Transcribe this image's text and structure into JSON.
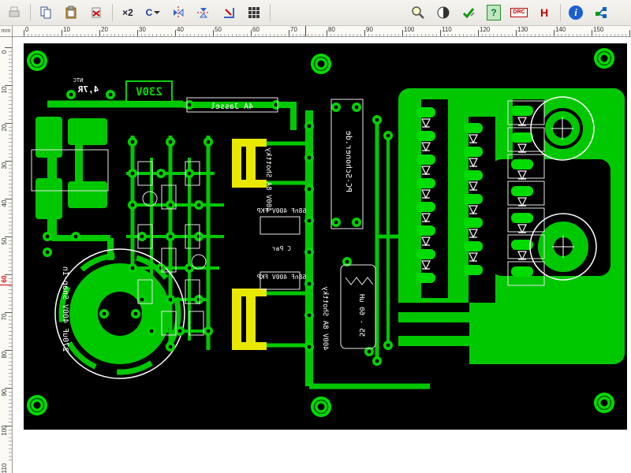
{
  "toolbar": {
    "icons": [
      "print",
      "copy",
      "paste",
      "delete",
      "scale-x2",
      "rotate",
      "mirror-horizontal",
      "mirror-vertical",
      "flip",
      "array",
      "zoom",
      "contrast",
      "check",
      "help",
      "drc",
      "highlight-h",
      "info",
      "footprint"
    ],
    "labels": {
      "scale_x2": "×2",
      "rotate": "C",
      "drc": "DRC",
      "h": "H",
      "help": "?",
      "info": "i"
    }
  },
  "rulers": {
    "unit": "mm",
    "h_ticks": [
      "0",
      "10",
      "20",
      "30",
      "40",
      "50",
      "60",
      "70",
      "80",
      "90",
      "100",
      "110",
      "120",
      "130",
      "140",
      "150"
    ],
    "v_ticks": [
      "0",
      "10",
      "20",
      "30",
      "40",
      "50",
      "60",
      "70",
      "80",
      "90",
      "100",
      "110"
    ]
  },
  "pcb": {
    "colors": {
      "board": "#000000",
      "copper": "#00c800",
      "pad": "#00dc00",
      "highlight_trace": "#e8e800",
      "silkscreen": "#ffffff"
    },
    "labels": [
      {
        "text": "NTC",
        "mirrored": true
      },
      {
        "text": "4,7R",
        "mirrored": true
      },
      {
        "text": "230V",
        "mirrored": true
      },
      {
        "text": "4A Jassel",
        "mirrored": true
      },
      {
        "text": "400V 8A Shottky",
        "mirrored": true
      },
      {
        "text": "68nF 400V FKP",
        "mirrored": true
      },
      {
        "text": "C Par",
        "mirrored": true
      },
      {
        "text": "68nF 400V FKP",
        "mirrored": true
      },
      {
        "text": "400V 8A Shottky",
        "mirrored": true
      },
      {
        "text": "270uF 400V Snap-In",
        "mirrored": true
      },
      {
        "text": "PC-Schoner.de",
        "mirrored": true
      },
      {
        "text": "55 - 60 uH",
        "mirrored": true
      }
    ]
  }
}
